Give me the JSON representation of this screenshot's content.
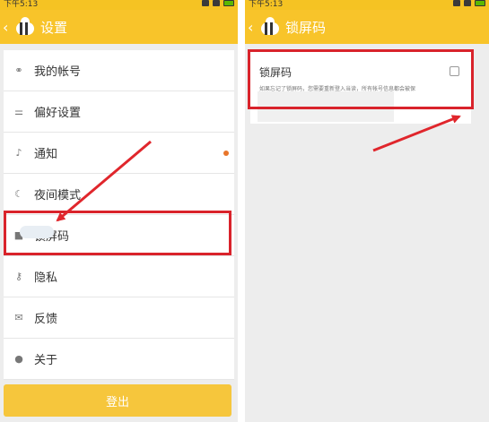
{
  "left_screen": {
    "status_time": "下午5:13",
    "title": "设置",
    "items": [
      {
        "label": "我的帐号",
        "icon": "link-icon"
      },
      {
        "label": "偏好设置",
        "icon": "sliders-icon"
      },
      {
        "label": "通知",
        "icon": "bell-icon"
      },
      {
        "label": "夜间模式",
        "icon": "moon-icon"
      },
      {
        "label": "锁屏码",
        "icon": "lock-icon"
      },
      {
        "label": "隐私",
        "icon": "key-icon"
      },
      {
        "label": "反馈",
        "icon": "mail-icon"
      },
      {
        "label": "关于",
        "icon": "info-icon"
      }
    ],
    "logout_label": "登出"
  },
  "right_screen": {
    "status_time": "下午5:13",
    "title": "锁屏码",
    "setting_title": "锁屏码",
    "setting_desc": "如果忘记了锁屏码，您需要重新登入当读，所有帐号信息都会被保",
    "checked": false
  },
  "colors": {
    "header": "#f8c42a",
    "highlight": "#d9232b",
    "arrow": "#e0262c",
    "notify_dot": "#e8752a"
  }
}
